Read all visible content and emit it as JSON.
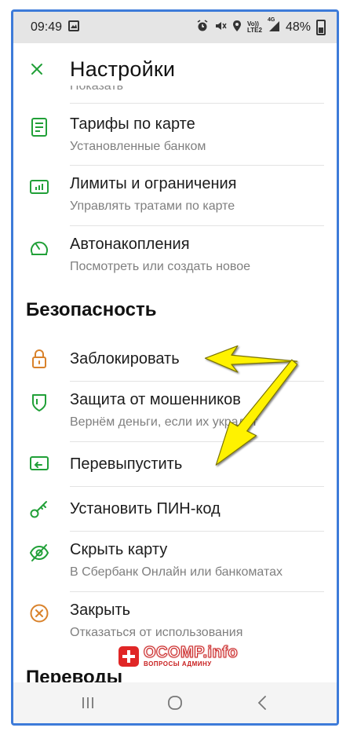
{
  "status_bar": {
    "time": "09:49",
    "network_top": "Vo))",
    "network_bottom": "LTE2",
    "signal_top": "4G",
    "battery_text": "48%"
  },
  "header": {
    "title": "Настройки"
  },
  "clipped_subtitle": "Показать",
  "items": [
    {
      "label": "Тарифы по карте",
      "subtitle": "Установленные банком",
      "icon": "document-list-icon"
    },
    {
      "label": "Лимиты и ограничения",
      "subtitle": "Управлять тратами по карте",
      "icon": "bar-chart-icon"
    },
    {
      "label": "Автонакопления",
      "subtitle": "Посмотреть или создать новое",
      "icon": "gauge-icon"
    }
  ],
  "security": {
    "title": "Безопасность",
    "items": [
      {
        "label": "Заблокировать",
        "subtitle": "",
        "icon": "lock-icon"
      },
      {
        "label": "Защита от мошенников",
        "subtitle": "Вернём деньги, если их украдут",
        "icon": "shield-icon"
      },
      {
        "label": "Перевыпустить",
        "subtitle": "",
        "icon": "reissue-card-icon"
      },
      {
        "label": "Установить ПИН-код",
        "subtitle": "",
        "icon": "key-icon"
      },
      {
        "label": "Скрыть карту",
        "subtitle": "В Сбербанк Онлайн или банкоматах",
        "icon": "eye-off-icon"
      },
      {
        "label": "Закрыть",
        "subtitle": "Отказаться от использования",
        "icon": "close-circle-icon"
      }
    ]
  },
  "transfers": {
    "title": "Переводы"
  },
  "watermark": {
    "main": "OCOMP.info",
    "sub": "ВОПРОСЫ АДМИНУ"
  },
  "colors": {
    "accent_green": "#21a038",
    "close_orange": "#d9822b",
    "border_blue": "#3d7bd9",
    "arrow_yellow": "#fff200"
  }
}
